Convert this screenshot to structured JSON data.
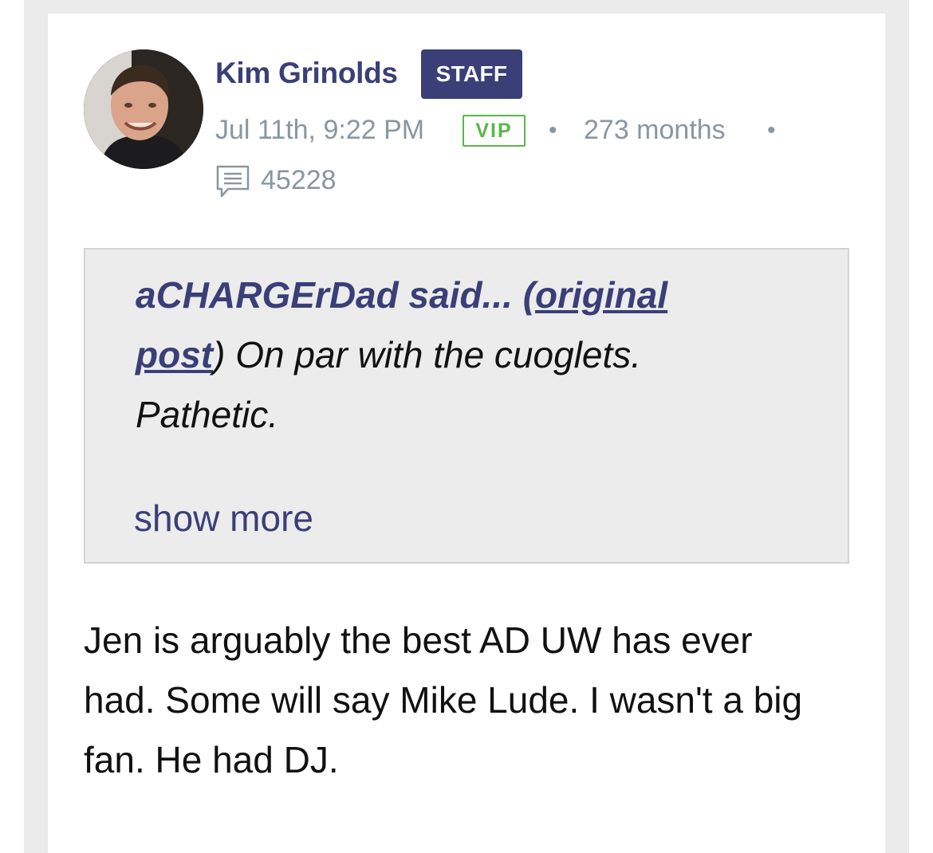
{
  "author": {
    "name": "Kim Grinolds",
    "role_badge": "STAFF",
    "avatar_icon": "user-avatar-photo"
  },
  "meta": {
    "timestamp": "Jul 11th, 9:22 PM",
    "vip_badge": "VIP",
    "separator": "•",
    "tenure": "273 months",
    "post_count": "45228",
    "post_count_icon": "comment-icon"
  },
  "quote": {
    "username": "aCHARGErDad",
    "said": "said...",
    "link_open": "(",
    "link_text": "original post",
    "link_close": ")",
    "text": " On par with the cuoglets. Pathetic.",
    "show_more": "show more"
  },
  "post": {
    "body": "Jen is arguably the best AD UW has ever had. Some will say Mike Lude. I wasn't a big fan. He had DJ."
  },
  "colors": {
    "brand": "#3a3f78",
    "vip": "#58b84a",
    "meta": "#8a96a0",
    "quote_bg": "#ececec"
  }
}
